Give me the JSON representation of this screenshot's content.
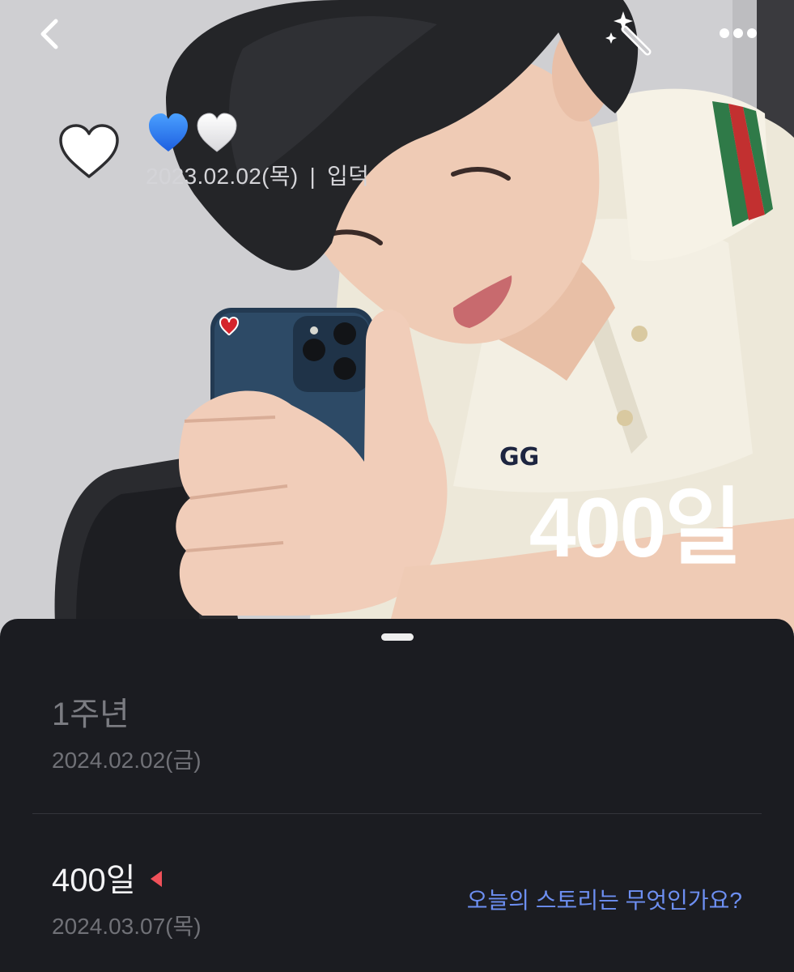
{
  "nav": {
    "back_icon": "chevron-left-icon",
    "magic_icon": "magic-wand-icon",
    "more_icon": "ellipsis-icon"
  },
  "entry": {
    "heart_icon": "white-heart-outline-icon",
    "emoji": "💙🤍",
    "date": "2023.02.02(목)",
    "separator": "|",
    "label": "입덕",
    "count": "400일"
  },
  "milestones": [
    {
      "title": "1주년",
      "date": "2024.02.02(금)"
    },
    {
      "title": "400일",
      "date": "2024.03.07(목)",
      "today_marker_color": "#f0515a"
    }
  ],
  "story_prompt": "오늘의 스토리는 무엇인가요?",
  "colors": {
    "sheet_bg": "#1b1c21",
    "accent_link": "#6d8ff2"
  }
}
